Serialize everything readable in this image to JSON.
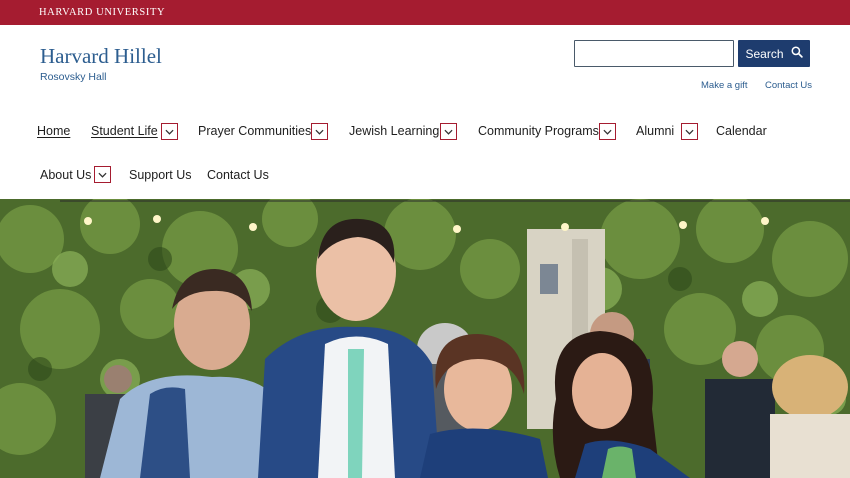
{
  "topbar": {
    "university": "HARVARD UNIVERSITY"
  },
  "brand": {
    "title": "Harvard Hillel",
    "subtitle": "Rosovsky Hall"
  },
  "search": {
    "placeholder": "",
    "button_label": "Search"
  },
  "utility_links": [
    "Make a gift",
    "Contact Us"
  ],
  "nav": {
    "home": "Home",
    "student_life": "Student Life",
    "prayer": "Prayer Communities",
    "learning": "Jewish Learning",
    "programs": "Community Programs",
    "alumni": "Alumni",
    "calendar": "Calendar",
    "about": "About Us",
    "support": "Support Us",
    "contact": "Contact Us"
  },
  "colors": {
    "crimson": "#a51c30",
    "navy": "#1e3c6e",
    "link_blue": "#2c5d8f"
  },
  "icons": {
    "search": "search-icon",
    "dropdown": "chevron-down-icon"
  }
}
